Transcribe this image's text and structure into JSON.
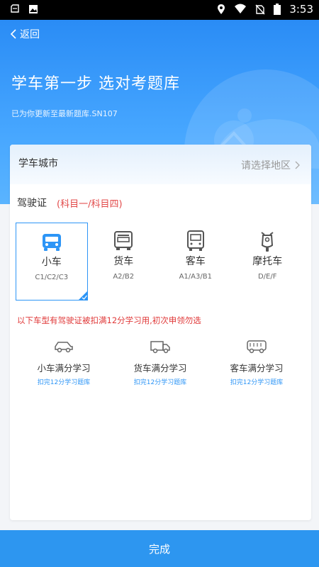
{
  "status_bar": {
    "time": "3:53"
  },
  "header": {
    "back_label": "返回",
    "title": "学车第一步 选对考题库",
    "subtitle": "已为你更新至最新题库.SN107"
  },
  "city": {
    "label": "学车城市",
    "placeholder": "请选择地区"
  },
  "license": {
    "label": "驾驶证",
    "subjects": "(科目一/科目四)",
    "vehicle_types": [
      {
        "name": "小车",
        "codes": "C1/C2/C3",
        "icon": "car-icon",
        "selected": true
      },
      {
        "name": "货车",
        "codes": "A2/B2",
        "icon": "truck-icon",
        "selected": false
      },
      {
        "name": "客车",
        "codes": "A1/A3/B1",
        "icon": "bus-icon",
        "selected": false
      },
      {
        "name": "摩托车",
        "codes": "D/E/F",
        "icon": "motorcycle-icon",
        "selected": false
      }
    ]
  },
  "warning": "以下车型有驾驶证被扣满12分学习用,初次申领勿选",
  "full_points": [
    {
      "name": "小车满分学习",
      "link": "扣完12分学习题库",
      "icon": "car-outline-icon"
    },
    {
      "name": "货车满分学习",
      "link": "扣完12分学习题库",
      "icon": "truck-outline-icon"
    },
    {
      "name": "客车满分学习",
      "link": "扣完12分学习题库",
      "icon": "bus-outline-icon"
    }
  ],
  "done_label": "完成",
  "colors": {
    "primary": "#2d95f6",
    "warning": "#e03a3a",
    "status_bar": "#000000"
  }
}
